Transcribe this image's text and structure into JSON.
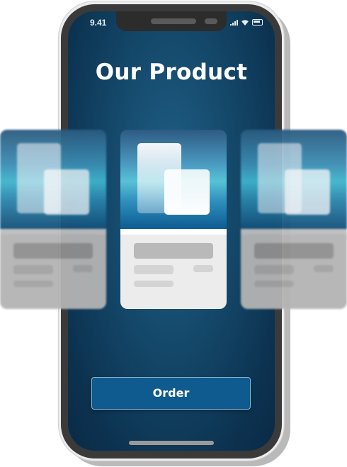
{
  "status_bar": {
    "time": "9.41",
    "icons": [
      "signal-icon",
      "wifi-icon",
      "battery-icon"
    ]
  },
  "page": {
    "title": "Our Product"
  },
  "carousel": {
    "cards": [
      {
        "position": "left",
        "state": "blurred"
      },
      {
        "position": "center",
        "state": "focused"
      },
      {
        "position": "right",
        "state": "blurred"
      }
    ]
  },
  "actions": {
    "order_label": "Order"
  },
  "colors": {
    "screen_background": "#0c3250",
    "button": "#0f5a8e",
    "card_accent": "#3fb4cc"
  }
}
